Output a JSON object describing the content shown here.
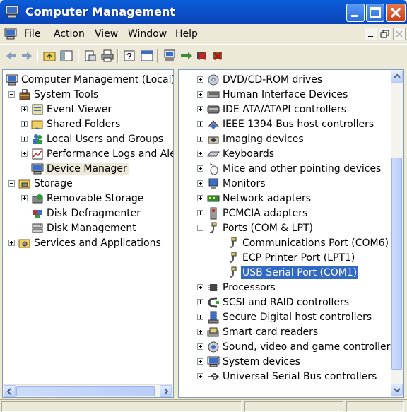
{
  "window": {
    "title": "Computer Management"
  },
  "menu": {
    "items": [
      "File",
      "Action",
      "View",
      "Window",
      "Help"
    ]
  },
  "tree": {
    "root": "Computer Management (Local)",
    "system_tools": "System Tools",
    "event_viewer": "Event Viewer",
    "shared_folders": "Shared Folders",
    "local_users": "Local Users and Groups",
    "perf_logs": "Performance Logs and Ale",
    "device_manager": "Device Manager",
    "storage": "Storage",
    "removable_storage": "Removable Storage",
    "disk_defrag": "Disk Defragmenter",
    "disk_mgmt": "Disk Management",
    "services": "Services and Applications"
  },
  "devices": {
    "dvd": "DVD/CD-ROM drives",
    "hid": "Human Interface Devices",
    "ide": "IDE ATA/ATAPI controllers",
    "ieee1394": "IEEE 1394 Bus host controllers",
    "imaging": "Imaging devices",
    "keyboards": "Keyboards",
    "mice": "Mice and other pointing devices",
    "monitors": "Monitors",
    "network": "Network adapters",
    "pcmcia": "PCMCIA adapters",
    "ports": "Ports (COM & LPT)",
    "com6": "Communications Port (COM6)",
    "lpt1": "ECP Printer Port (LPT1)",
    "com1": "USB Serial Port (COM1)",
    "processors": "Processors",
    "scsi": "SCSI and RAID controllers",
    "sdhost": "Secure Digital host controllers",
    "smartcard": "Smart card readers",
    "sound": "Sound, video and game controllers",
    "system": "System devices",
    "usb": "Universal Serial Bus controllers"
  }
}
